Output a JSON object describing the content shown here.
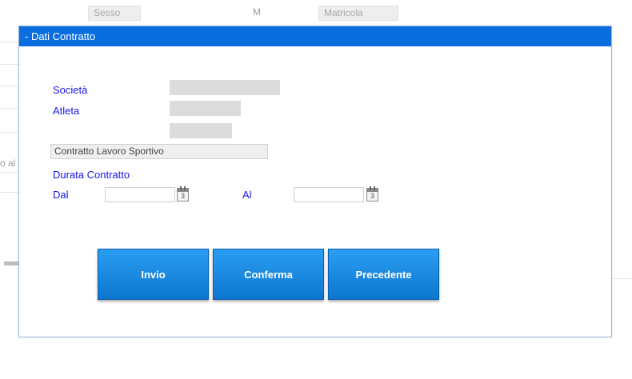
{
  "background": {
    "sesso_label": "Sesso",
    "sesso_value": "M",
    "matricola_label": "Matricola",
    "left_fragment": "o al"
  },
  "modal": {
    "title": "- Dati Contratto",
    "labels": {
      "societa": "Società",
      "atleta": "Atleta",
      "durata": "Durata Contratto",
      "dal": "Dal",
      "al": "Al"
    },
    "contract_type": "Contratto Lavoro Sportivo",
    "dal_value": "",
    "al_value": "",
    "calendar_day": "3",
    "buttons": {
      "invio": "Invio",
      "conferma": "Conferma",
      "precedente": "Precedente"
    }
  },
  "colors": {
    "header": "#0a6ee0",
    "label": "#1616e6",
    "button": "#1b8be3"
  }
}
